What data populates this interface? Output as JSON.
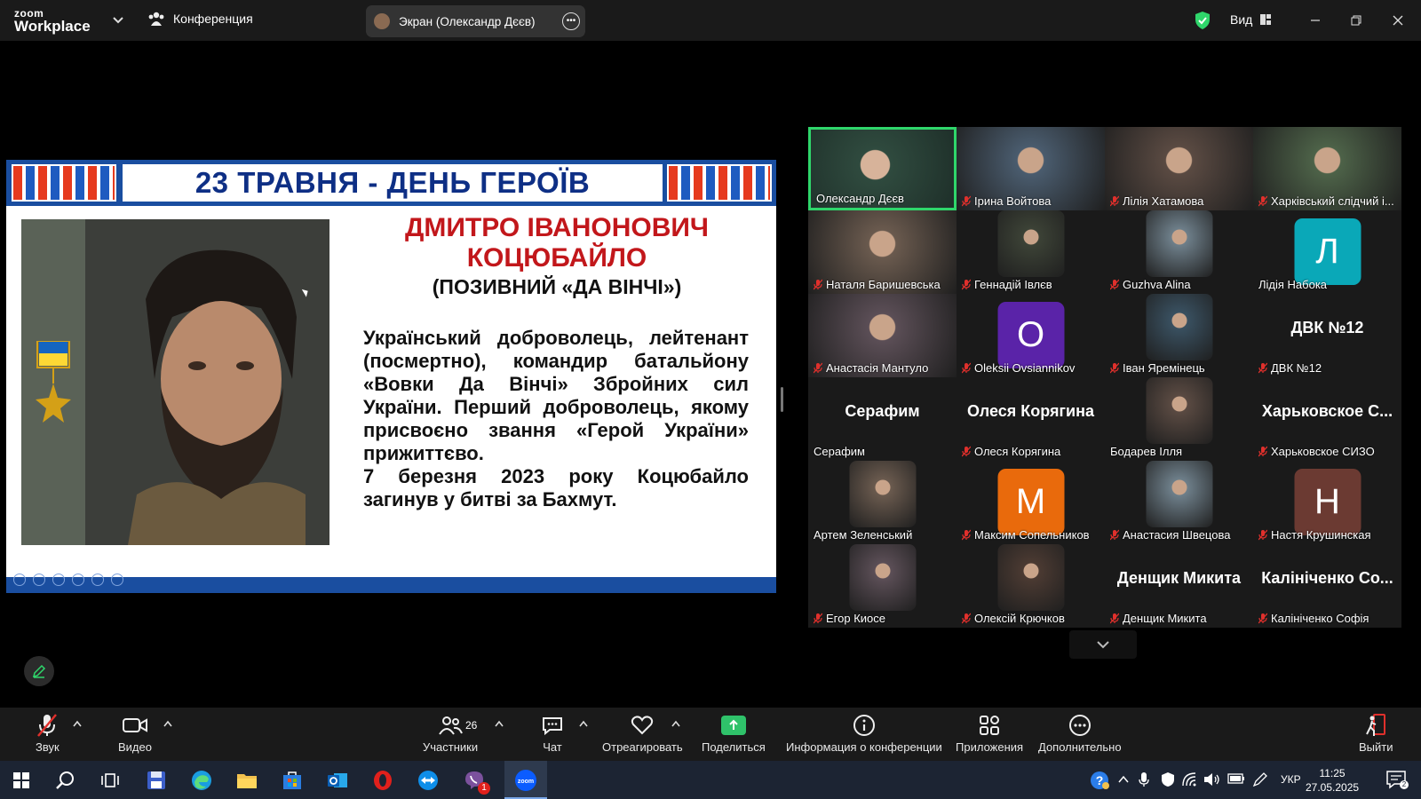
{
  "app": {
    "logo_top": "zoom",
    "logo_bottom": "Workplace",
    "conference_label": "Конференция",
    "screen_share_label": "Экран (Олександр Дєєв)",
    "view_label": "Вид",
    "accent": "#2fd66b"
  },
  "slide": {
    "title": "23 ТРАВНЯ - ДЕНЬ ГЕРОЇВ",
    "name_line1": "ДМИТРО ІВАНОНОВИЧ",
    "name_line2": "КОЦЮБАЙЛО",
    "callsign": "(ПОЗИВНИЙ «ДА ВІНЧІ»)",
    "bio": "Український доброволець, лейтенант (посмертно), командир батальйону «Вовки Да Вінчі» Збройних сил України. Перший доброволець, якому присвоєно звання «Герой України» прижиттєво.",
    "bio_death": "7 березня 2023 року Коцюбайло загинув у битві за Бахмут.",
    "title_color": "#0e2f85",
    "name_color": "#c2171b"
  },
  "participants": [
    {
      "name": "Олександр Дєєв",
      "muted": false,
      "type": "video",
      "active": true
    },
    {
      "name": "Ірина Войтова",
      "muted": true,
      "type": "video"
    },
    {
      "name": "Лілія Хатамова",
      "muted": true,
      "type": "video"
    },
    {
      "name": "Харківський слідчий і...",
      "muted": true,
      "type": "video"
    },
    {
      "name": "Наталя Баришевська",
      "muted": true,
      "type": "video"
    },
    {
      "name": "Геннадій Івлєв",
      "muted": true,
      "type": "video"
    },
    {
      "name": "Guzhva Alina",
      "muted": true,
      "type": "video"
    },
    {
      "name": "Лідія Набока",
      "muted": false,
      "type": "letter",
      "letter": "Л",
      "color": "#0aa8b8"
    },
    {
      "name": "Анастасія Мантуло",
      "muted": true,
      "type": "video"
    },
    {
      "name": "Oleksii Ovsiannikov",
      "muted": true,
      "type": "letter",
      "letter": "O",
      "color": "#5a23a8"
    },
    {
      "name": "Іван Яремінець",
      "muted": true,
      "type": "video"
    },
    {
      "name": "ДВК №12",
      "muted": true,
      "type": "text",
      "big": "ДВК №12"
    },
    {
      "name": "Серафим",
      "muted": false,
      "type": "text",
      "big": "Серафим"
    },
    {
      "name": "Олеся Корягина",
      "muted": true,
      "type": "text",
      "big": "Олеся Корягина"
    },
    {
      "name": "Бодарев Ілля",
      "muted": false,
      "type": "video"
    },
    {
      "name": "Харьковское СИЗО",
      "muted": true,
      "type": "text",
      "big": "Харьковское С..."
    },
    {
      "name": "Артем Зеленський",
      "muted": false,
      "type": "video"
    },
    {
      "name": "Максим Сопельников",
      "muted": true,
      "type": "letter",
      "letter": "M",
      "color": "#e96a0c"
    },
    {
      "name": "Анастасия Швецова",
      "muted": true,
      "type": "video"
    },
    {
      "name": "Настя Крушинская",
      "muted": true,
      "type": "letter",
      "letter": "Н",
      "color": "#6b3a32"
    },
    {
      "name": "Егор Киосе",
      "muted": true,
      "type": "video"
    },
    {
      "name": "Олексій Крючков",
      "muted": true,
      "type": "video"
    },
    {
      "name": "Денщик Микита",
      "muted": true,
      "type": "text",
      "big": "Денщик Микита"
    },
    {
      "name": "Калініченко Софія",
      "muted": true,
      "type": "text",
      "big": "Калініченко Со..."
    }
  ],
  "toolbar": {
    "audio": "Звук",
    "video": "Видео",
    "participants": "Участники",
    "participants_count": "26",
    "chat": "Чат",
    "react": "Отреагировать",
    "share": "Поделиться",
    "info": "Информация о конференции",
    "apps": "Приложения",
    "more": "Дополнительно",
    "leave": "Выйти"
  },
  "taskbar": {
    "lang": "УКР",
    "time": "11:25",
    "date": "27.05.2025",
    "badge": "1"
  }
}
